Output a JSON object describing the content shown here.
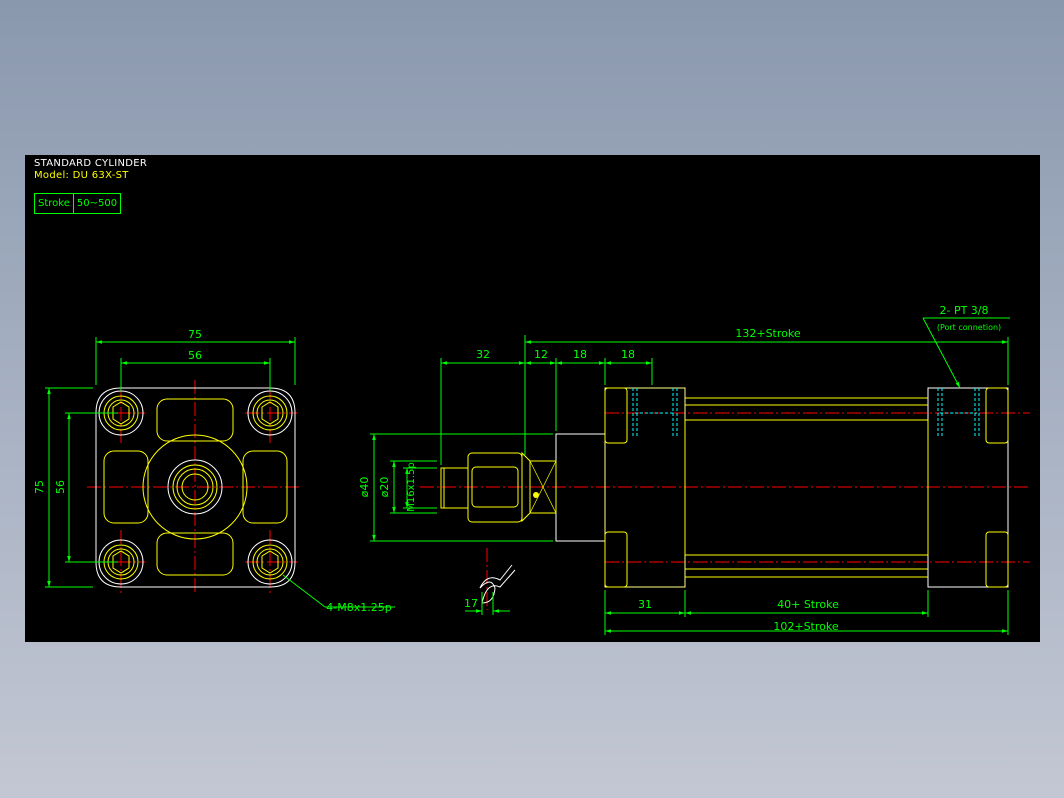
{
  "title": {
    "name": "STANDARD CYLINDER",
    "model": "Model: DU 63X-ST"
  },
  "stroke_table": {
    "label": "Stroke",
    "value": "50~500"
  },
  "dims": {
    "front_width": "75",
    "front_pitch": "56",
    "front_height": "75",
    "front_pitch_v": "56",
    "front_callout": "4-M8x1.25p",
    "rod_length": "32",
    "seg_12": "12",
    "seg_18a": "18",
    "seg_18b": "18",
    "total_top": "132+Stroke",
    "port_label": "2- PT 3/8",
    "port_sub": "(Port connetion)",
    "dia_40": "ø40",
    "dia_20": "ø20",
    "thread": "M16x1.5p",
    "wrench": "17",
    "seg_31": "31",
    "seg_40": "40+ Stroke",
    "total_bottom": "102+Stroke"
  },
  "colors": {
    "dim": "#00ff00",
    "part": "#ffff00",
    "center": "#ff0000",
    "hidden": "#00ffff",
    "text_header": "#ffffff",
    "text_model": "#ffff00"
  }
}
